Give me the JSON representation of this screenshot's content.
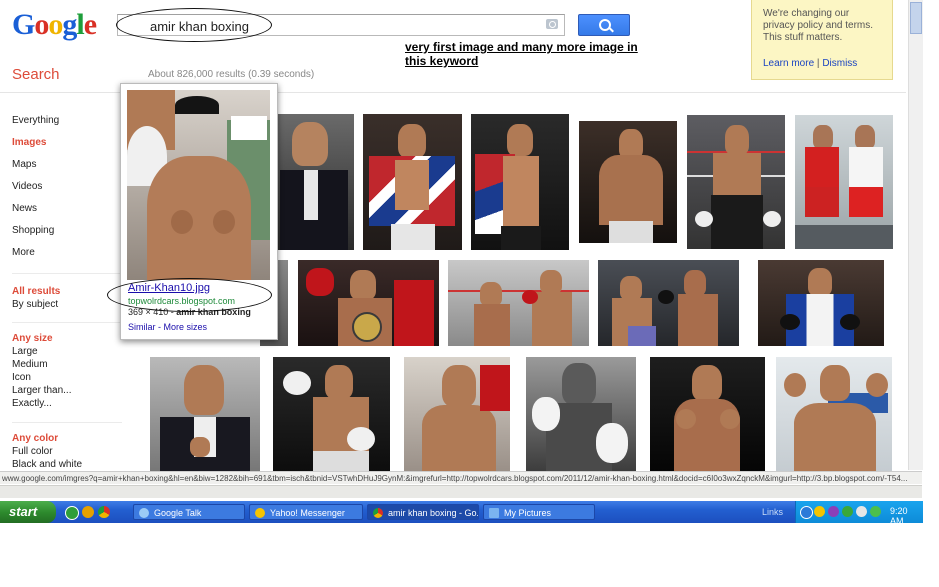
{
  "logo": {
    "letters": [
      "G",
      "o",
      "o",
      "g",
      "l",
      "e"
    ]
  },
  "search": {
    "query": "amir khan boxing"
  },
  "annotation": "very first image and many more image in this keyword",
  "privacy": {
    "text": "We're changing our privacy policy and terms. This stuff matters.",
    "learn_more": "Learn more",
    "separator": "|",
    "dismiss": "Dismiss"
  },
  "sidebar": {
    "title": "Search",
    "items": [
      "Everything",
      "Images",
      "Maps",
      "Videos",
      "News",
      "Shopping",
      "More"
    ],
    "active_item": "Images",
    "results_group": {
      "heading": "All results",
      "items": [
        "By subject"
      ]
    },
    "size_group": {
      "heading": "Any size",
      "items": [
        "Large",
        "Medium",
        "Icon",
        "Larger than...",
        "Exactly..."
      ]
    },
    "color_group": {
      "heading": "Any color",
      "items": [
        "Full color",
        "Black and white"
      ]
    }
  },
  "results": {
    "count_text": "About 826,000 results (0.39 seconds)"
  },
  "popup": {
    "title": "Amir-Khan10.jpg",
    "url": "topwolrdcars.blogspot.com",
    "size_text": "369 × 410 - ",
    "size_bold": "amir khan boxing",
    "similar": "Similar",
    "sep": " - ",
    "more_sizes": "More sizes"
  },
  "statusbar": {
    "url": "www.google.com/imgres?q=amir+khan+boxing&hl=en&biw=1282&bih=691&tbm=isch&tbnid=VSTwhDHuJ9GynM:&imgrefurl=http://topwolrdcars.blogspot.com/2011/12/amir-khan-boxing.html&docid=c6I0o3wxZqnckM&imgurl=http://3.bp.blogspot.com/-T54..."
  },
  "taskbar": {
    "start": "start",
    "tasks": [
      {
        "label": "Google Talk",
        "active": false
      },
      {
        "label": "Yahoo! Messenger",
        "active": false
      },
      {
        "label": "amir khan boxing - Go...",
        "active": true
      },
      {
        "label": "My Pictures",
        "active": false
      }
    ],
    "links": "Links",
    "clock": "9:20 AM"
  },
  "colors": {
    "accent_red": "#dd4b39",
    "link_blue": "#1a0dab",
    "url_green": "#1e8a3a",
    "search_blue": "#4d90fe"
  }
}
